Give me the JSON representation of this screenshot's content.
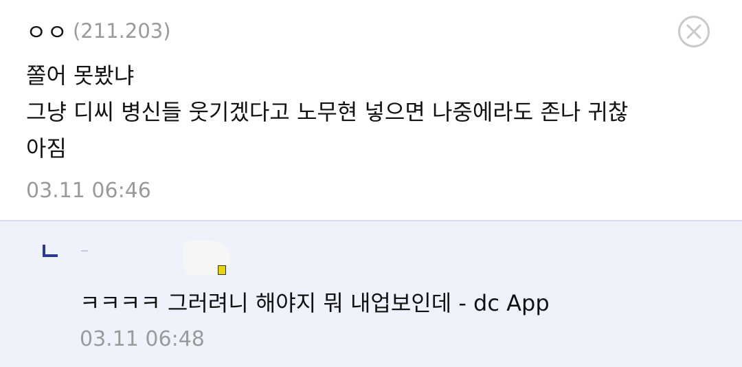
{
  "comment": {
    "nickname": "ㅇㅇ",
    "ip": "(211.203)",
    "lines": [
      "쫄어 못봤냐",
      "그냥 디씨 병신들 웃기겠다고 노무현 넣으면 나중에라도 존나 귀찮",
      "아짐"
    ],
    "timestamp": "03.11 06:46",
    "close_icon": "close-circle-icon"
  },
  "reply": {
    "reply_marker_icon": "reply-corner-icon",
    "text": "ㅋㅋㅋㅋ 그러려니 해야지 뭐 내업보인데 - dc App",
    "timestamp": "03.11 06:48"
  },
  "colors": {
    "reply_background": "#eff2fb",
    "reply_border": "#d6ddef",
    "reply_marker": "#2b3a8c",
    "muted_text": "#9a9a9a"
  }
}
